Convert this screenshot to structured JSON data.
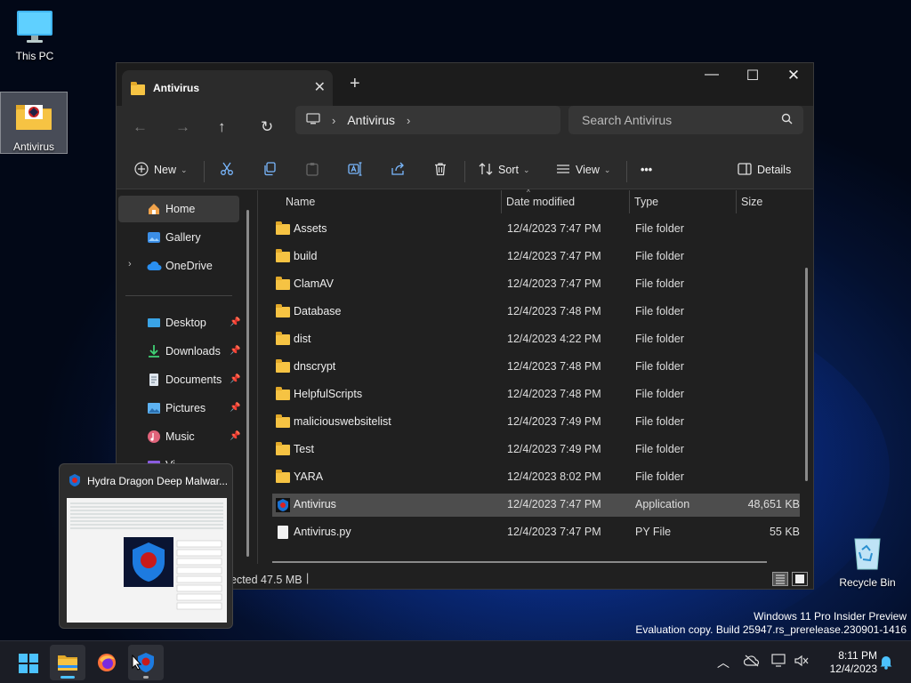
{
  "desktop": {
    "icons": [
      {
        "label": "This PC"
      },
      {
        "label": "Antivirus"
      },
      {
        "label": "Recycle Bin"
      }
    ],
    "watermark": {
      "line1": "Windows 11 Pro Insider Preview",
      "line2": "Evaluation copy. Build 25947.rs_prerelease.230901-1416"
    }
  },
  "window": {
    "tab_title": "Antivirus",
    "breadcrumb": [
      "Antivirus"
    ],
    "search_placeholder": "Search Antivirus",
    "toolbar": {
      "new_label": "New",
      "sort_label": "Sort",
      "view_label": "View",
      "more_label": "•••",
      "details_label": "Details"
    },
    "sidebar": {
      "items": [
        {
          "label": "Home",
          "icon": "home-icon"
        },
        {
          "label": "Gallery",
          "icon": "gallery-icon"
        },
        {
          "label": "OneDrive",
          "icon": "cloud-icon"
        },
        {
          "label": "Desktop",
          "icon": "desktop-icon"
        },
        {
          "label": "Downloads",
          "icon": "download-icon"
        },
        {
          "label": "Documents",
          "icon": "document-icon"
        },
        {
          "label": "Pictures",
          "icon": "picture-icon"
        },
        {
          "label": "Music",
          "icon": "music-icon"
        },
        {
          "label": "Vi",
          "icon": "video-icon"
        }
      ]
    },
    "columns": {
      "name": "Name",
      "date": "Date modified",
      "type": "Type",
      "size": "Size"
    },
    "files": [
      {
        "name": "Assets",
        "date": "12/4/2023 7:47 PM",
        "type": "File folder",
        "size": ""
      },
      {
        "name": "build",
        "date": "12/4/2023 7:47 PM",
        "type": "File folder",
        "size": ""
      },
      {
        "name": "ClamAV",
        "date": "12/4/2023 7:47 PM",
        "type": "File folder",
        "size": ""
      },
      {
        "name": "Database",
        "date": "12/4/2023 7:48 PM",
        "type": "File folder",
        "size": ""
      },
      {
        "name": "dist",
        "date": "12/4/2023 4:22 PM",
        "type": "File folder",
        "size": ""
      },
      {
        "name": "dnscrypt",
        "date": "12/4/2023 7:48 PM",
        "type": "File folder",
        "size": ""
      },
      {
        "name": "HelpfulScripts",
        "date": "12/4/2023 7:48 PM",
        "type": "File folder",
        "size": ""
      },
      {
        "name": "maliciouswebsitelist",
        "date": "12/4/2023 7:49 PM",
        "type": "File folder",
        "size": ""
      },
      {
        "name": "Test",
        "date": "12/4/2023 7:49 PM",
        "type": "File folder",
        "size": ""
      },
      {
        "name": "YARA",
        "date": "12/4/2023 8:02 PM",
        "type": "File folder",
        "size": ""
      },
      {
        "name": "Antivirus",
        "date": "12/4/2023 7:47 PM",
        "type": "Application",
        "size": "48,651 KB"
      },
      {
        "name": "Antivirus.py",
        "date": "12/4/2023 7:47 PM",
        "type": "PY File",
        "size": "55 KB"
      }
    ],
    "status": {
      "selection": "ected  47.5 MB"
    }
  },
  "thumbnail": {
    "title": "Hydra Dragon Deep Malwar..."
  },
  "taskbar": {
    "apps": [
      "start-icon",
      "file-explorer-icon",
      "firefox-icon",
      "hydra-dragon-icon"
    ],
    "clock_time": "8:11 PM",
    "clock_date": "12/4/2023"
  },
  "colors": {
    "accent": "#4cc2ff",
    "folder": "#f6c343",
    "selected_row": "#4d4d4d"
  }
}
